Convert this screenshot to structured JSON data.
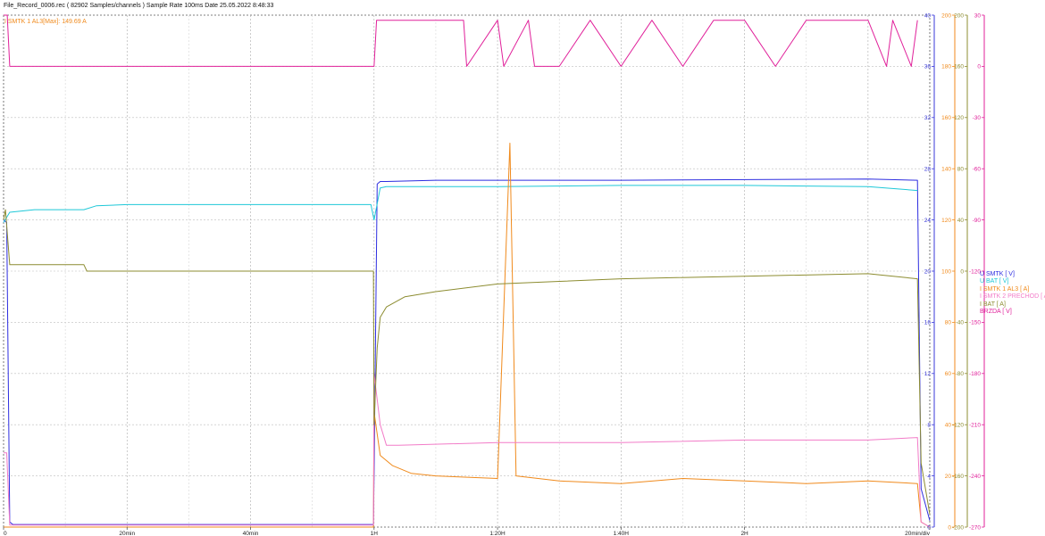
{
  "header": {
    "title": "File_Record_0006.rec  ( 82902 Samples/channels )  Sample Rate  100ms  Date  25.05.2022  8:48:33",
    "annotation": "I SMTK 1 AL3[Max]: 149.69 A"
  },
  "chart_data": {
    "type": "line",
    "x_axis": {
      "ticks": [
        "0",
        "20min",
        "40min",
        "1H",
        "1:20H",
        "1:40H",
        "2H",
        "20min/div"
      ],
      "range_min": [
        0,
        150
      ]
    },
    "axes": {
      "u_v": {
        "range": [
          0,
          40
        ],
        "ticks": [
          "0",
          "4",
          "8",
          "12",
          "16",
          "20",
          "24",
          "28",
          "32",
          "36",
          "40"
        ],
        "color": "#3a3ad8"
      },
      "i_smtk_a": {
        "range": [
          0,
          200
        ],
        "ticks": [
          "0",
          "20",
          "40",
          "60",
          "80",
          "100",
          "120",
          "140",
          "160",
          "180",
          "200"
        ],
        "color": "#f08a1c"
      },
      "i_bat_a": {
        "range": [
          -200,
          200
        ],
        "ticks": [
          "-200",
          "-160",
          "-120",
          "-80",
          "-40",
          "0",
          "40",
          "80",
          "120",
          "160",
          "200"
        ],
        "color": "#8c8c30"
      },
      "brzda_v": {
        "range": [
          -270,
          30
        ],
        "ticks": [
          "-270",
          "-240",
          "-210",
          "-180",
          "-150",
          "-120",
          "-90",
          "-60",
          "-30",
          "0",
          "30"
        ],
        "color": "#e0209a"
      }
    },
    "grid": true,
    "legend": "right",
    "series": [
      {
        "name": "U SMTK [ V]",
        "color": "#2d2de0",
        "axis": "u_v",
        "x": [
          0,
          0.5,
          1,
          1.5,
          59.9,
          60,
          60.5,
          61,
          62,
          70,
          100,
          140,
          148,
          148.6,
          150
        ],
        "y": [
          24,
          23.8,
          0.4,
          0.2,
          0.2,
          4,
          26.8,
          27,
          27,
          27.1,
          27.1,
          27.2,
          27.1,
          3,
          0.5
        ]
      },
      {
        "name": "U BAT [ V]",
        "color": "#1ec8d8",
        "axis": "u_v",
        "x": [
          0,
          1,
          5,
          13,
          15,
          20,
          40,
          59.5,
          60,
          61,
          62,
          80,
          100,
          120,
          140,
          148
        ],
        "y": [
          23.8,
          24.6,
          24.8,
          24.8,
          25.1,
          25.2,
          25.2,
          25.2,
          24,
          26.5,
          26.6,
          26.6,
          26.7,
          26.7,
          26.6,
          26.3
        ]
      },
      {
        "name": "I SMTK 1 AL3 [ A]",
        "color": "#f08a1c",
        "axis": "i_smtk_a",
        "x": [
          0,
          59.9,
          60,
          61,
          63,
          66,
          70,
          80,
          82,
          83,
          90,
          100,
          110,
          120,
          130,
          140,
          148,
          148.6,
          150
        ],
        "y": [
          0,
          0,
          45,
          28,
          24,
          21,
          20,
          19,
          150,
          20,
          18,
          17,
          19,
          18,
          17,
          18,
          17,
          2,
          0
        ]
      },
      {
        "name": "I SMTK 2 PRECHOD [ A]",
        "color": "#f27cc8",
        "axis": "i_smtk_a",
        "x": [
          0,
          0.5,
          1,
          59.9,
          60,
          61,
          62,
          64,
          80,
          100,
          120,
          140,
          148,
          148.6,
          150
        ],
        "y": [
          29,
          29,
          0.8,
          0.8,
          60,
          40,
          32,
          32,
          33,
          33,
          34,
          34,
          35,
          2,
          0
        ]
      },
      {
        "name": "I BAT [ A]",
        "color": "#8c8c30",
        "axis": "i_bat_a",
        "x": [
          0,
          0.3,
          1,
          13,
          13.5,
          40,
          59.9,
          60,
          60.5,
          61,
          62,
          65,
          70,
          80,
          90,
          100,
          120,
          140,
          148,
          148.6,
          150
        ],
        "y": [
          40,
          48,
          5,
          5,
          0,
          0,
          0,
          -120,
          -60,
          -36,
          -28,
          -20,
          -16,
          -10,
          -8,
          -6,
          -4,
          -2,
          -6,
          -150,
          -190
        ]
      },
      {
        "name": "BRZDA [ V]",
        "color": "#e0209a",
        "axis": "brzda_v",
        "x": [
          0,
          0.6,
          1,
          59.9,
          60,
          60.4,
          74.5,
          75,
          80,
          81,
          85,
          86,
          90,
          95,
          100,
          105,
          110,
          115,
          120,
          125,
          130,
          140,
          143,
          144,
          147,
          148
        ],
        "y": [
          30,
          30,
          0,
          0,
          0,
          27,
          27,
          0,
          27,
          0,
          27,
          0,
          0,
          27,
          0,
          27,
          0,
          27,
          27,
          0,
          27,
          27,
          0,
          27,
          0,
          27
        ]
      }
    ]
  }
}
